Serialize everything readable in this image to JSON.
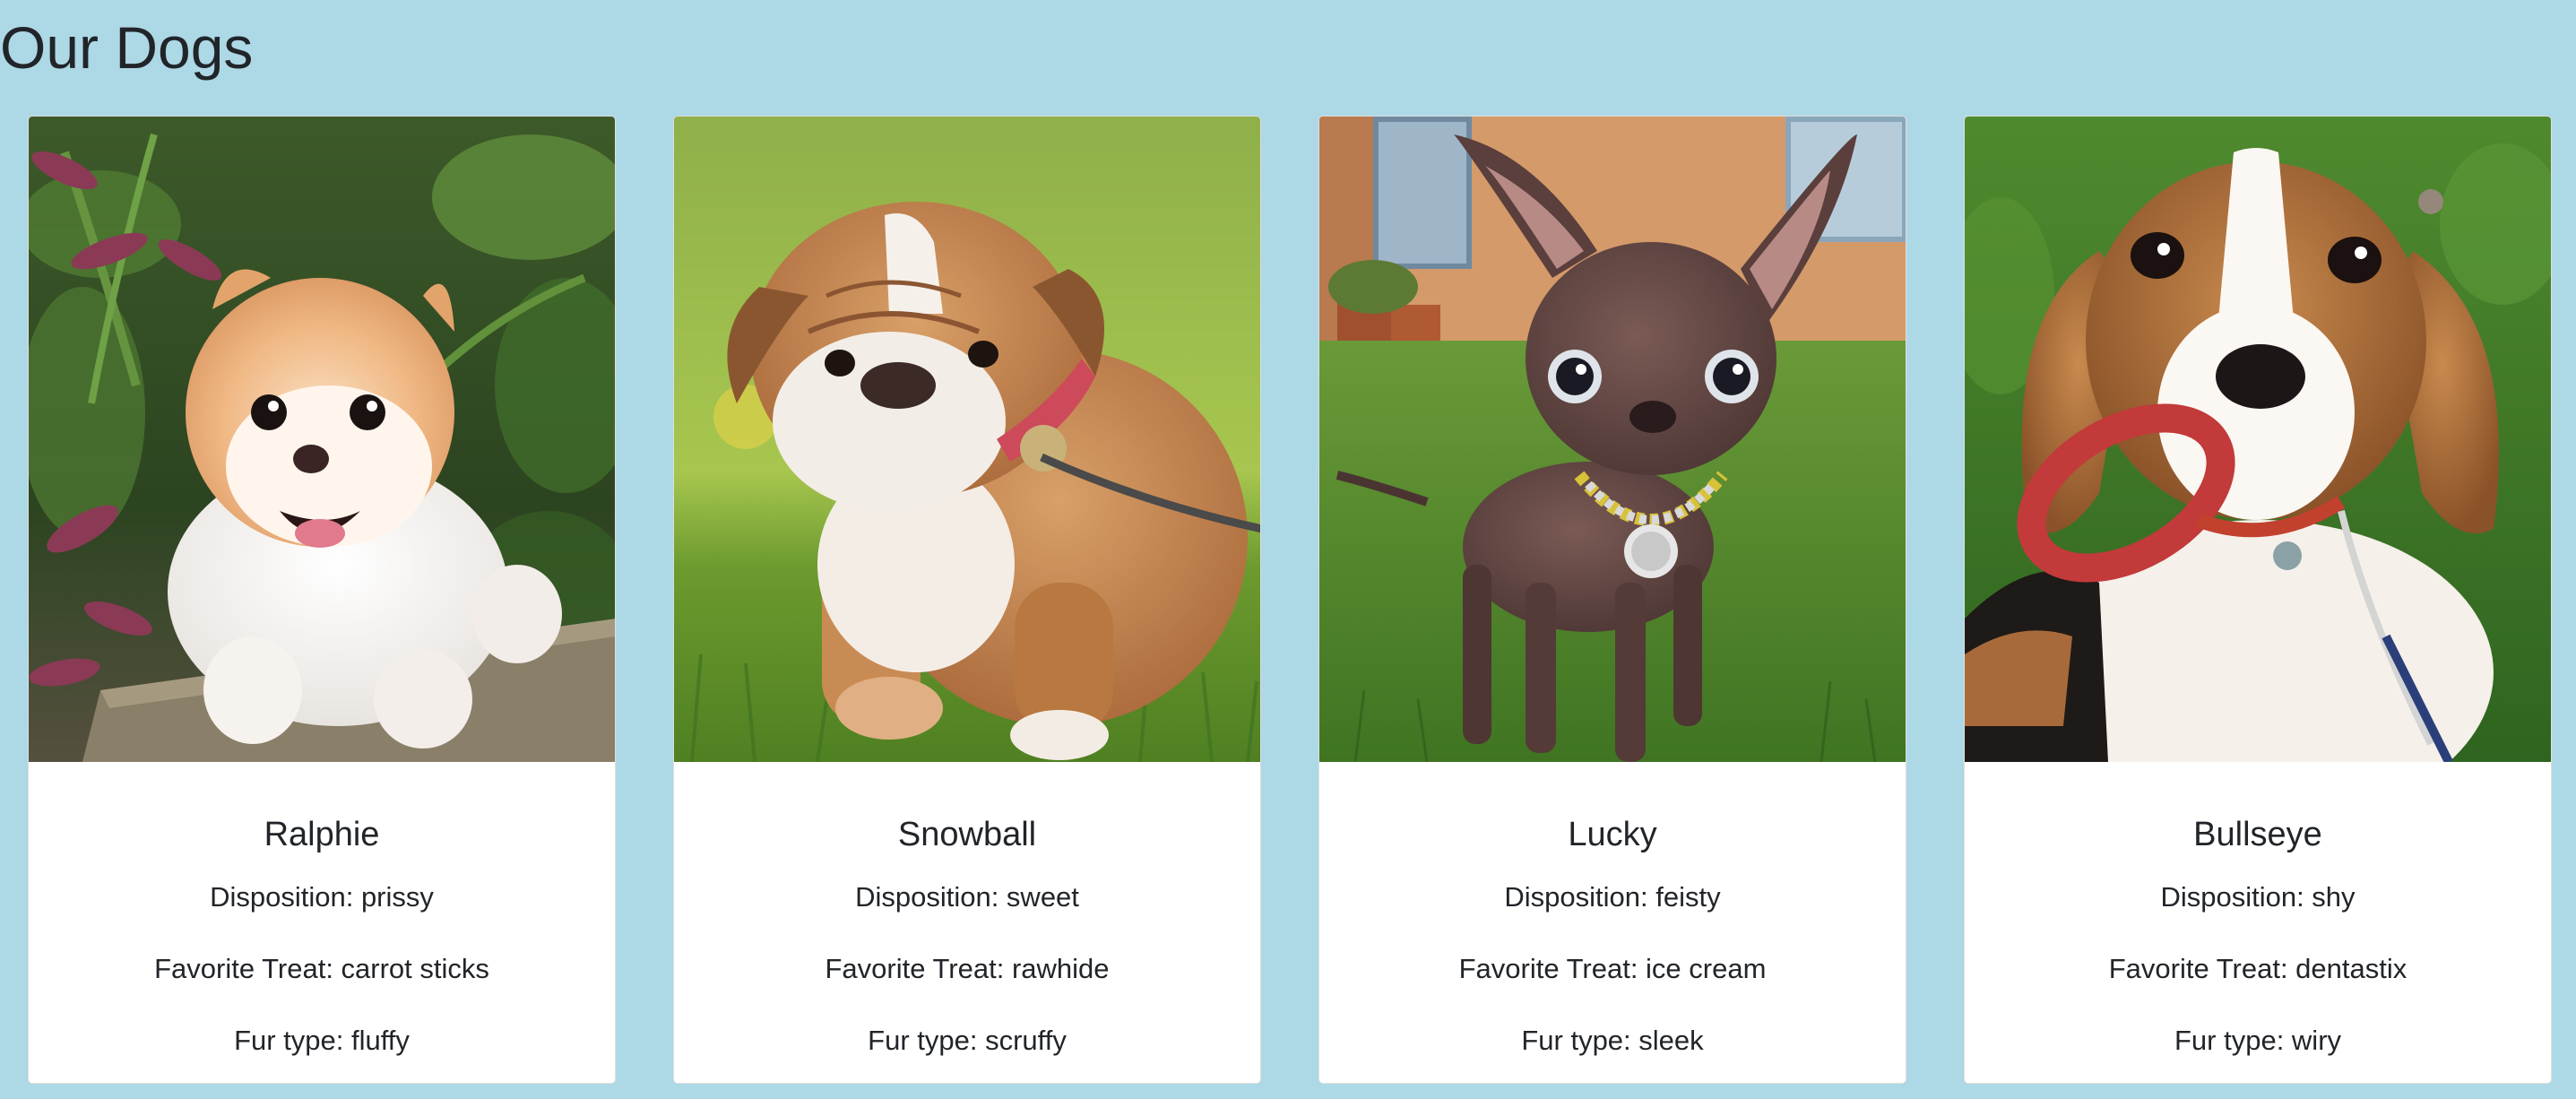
{
  "page": {
    "title": "Our Dogs"
  },
  "colors": {
    "background": "#add8e6",
    "card": "#ffffff",
    "text": "#212529"
  },
  "dogs": [
    {
      "name": "Ralphie",
      "disposition": "Disposition: prissy",
      "treat": "Favorite Treat: carrot sticks",
      "fur": "Fur type: fluffy",
      "photo_icon": "pomeranian-photo"
    },
    {
      "name": "Snowball",
      "disposition": "Disposition: sweet",
      "treat": "Favorite Treat: rawhide",
      "fur": "Fur type: scruffy",
      "photo_icon": "bulldog-puppy-photo"
    },
    {
      "name": "Lucky",
      "disposition": "Disposition: feisty",
      "treat": "Favorite Treat: ice cream",
      "fur": "Fur type: sleek",
      "photo_icon": "chihuahua-photo"
    },
    {
      "name": "Bullseye",
      "disposition": "Disposition: shy",
      "treat": "Favorite Treat: dentastix",
      "fur": "Fur type: wiry",
      "photo_icon": "beagle-photo"
    }
  ]
}
